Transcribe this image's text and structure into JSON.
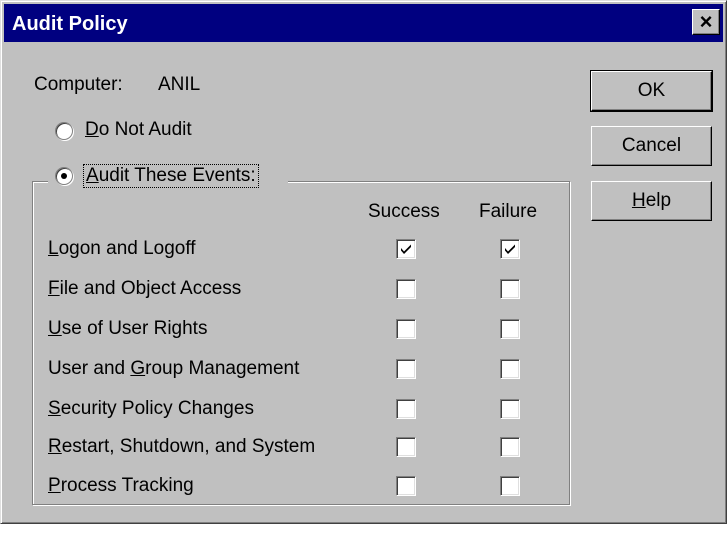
{
  "window": {
    "title": "Audit Policy"
  },
  "computer": {
    "label": "Computer:",
    "name": "ANIL"
  },
  "options": {
    "do_not_audit": {
      "label_pre": "",
      "accel": "D",
      "label_post": "o Not Audit",
      "selected": false
    },
    "audit_these": {
      "label_pre": "",
      "accel": "A",
      "label_post": "udit These Events:",
      "selected": true
    }
  },
  "columns": {
    "success": "Success",
    "failure": "Failure"
  },
  "events": [
    {
      "pre": "",
      "accel": "L",
      "post": "ogon and Logoff",
      "success": true,
      "failure": true
    },
    {
      "pre": "",
      "accel": "F",
      "post": "ile and Object Access",
      "success": false,
      "failure": false
    },
    {
      "pre": "",
      "accel": "U",
      "post": "se of User Rights",
      "success": false,
      "failure": false
    },
    {
      "pre": "User and ",
      "accel": "G",
      "post": "roup Management",
      "success": false,
      "failure": false
    },
    {
      "pre": "",
      "accel": "S",
      "post": "ecurity Policy Changes",
      "success": false,
      "failure": false
    },
    {
      "pre": "",
      "accel": "R",
      "post": "estart, Shutdown, and System",
      "success": false,
      "failure": false
    },
    {
      "pre": "",
      "accel": "P",
      "post": "rocess Tracking",
      "success": false,
      "failure": false
    }
  ],
  "buttons": {
    "ok": {
      "label": "OK"
    },
    "cancel": {
      "label": "Cancel"
    },
    "help": {
      "accel": "H",
      "post": "elp"
    }
  },
  "icons": {
    "close": "close-icon"
  }
}
